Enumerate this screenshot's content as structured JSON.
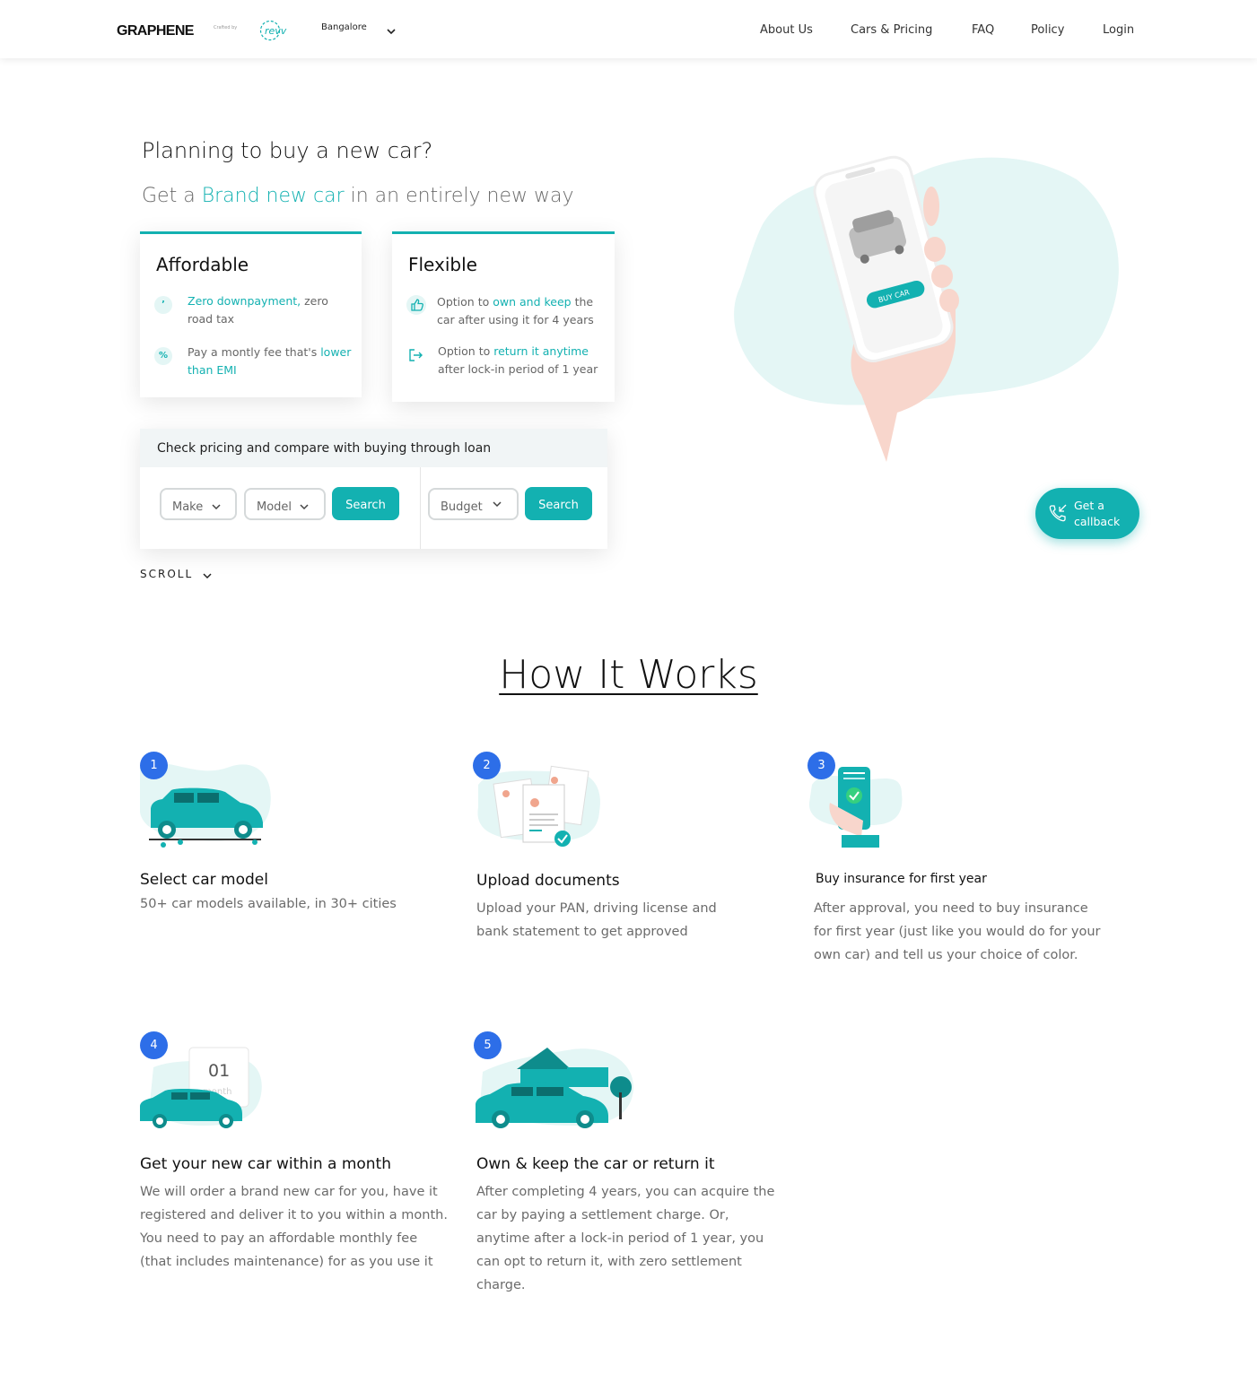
{
  "nav": {
    "logo": "GRAPHENE",
    "crafted_by": "Crafted by",
    "partner": "revv",
    "city": "Bangalore",
    "links": [
      "About Us",
      "Cars & Pricing",
      "FAQ",
      "Policy",
      "Login"
    ]
  },
  "hero": {
    "title": "Planning to buy a new car?",
    "sub_prefix": "Get a ",
    "sub_accent": "Brand new car",
    "sub_suffix": " in an entirely new way",
    "phone_button": "BUY CAR"
  },
  "cards": {
    "affordable": {
      "title": "Affordable",
      "f1_icon": "’",
      "f1_hl": "Zero downpayment,",
      "f1_rest": " zero road tax",
      "f2_icon": "%",
      "f2_pre": "Pay a montly fee that's ",
      "f2_hl": "lower than EMI"
    },
    "flexible": {
      "title": "Flexible",
      "f1_pre": "Option to ",
      "f1_hl": "own and keep",
      "f1_rest": " the car after using it for 4 years",
      "f2_pre": "Option to ",
      "f2_hl": "return it anytime",
      "f2_rest": " after lock-in period of 1 year"
    }
  },
  "pricing": {
    "heading": "Check pricing and compare with buying through loan",
    "make": "Make",
    "model": "Model",
    "budget": "Budget",
    "search": "Search"
  },
  "scroll_label": "SCROLL",
  "callback": {
    "line1": "Get a",
    "line2": "callback"
  },
  "how_it_works": {
    "title": "How It Works",
    "steps": [
      {
        "num": "1",
        "title": "Select car model",
        "desc": "50+ car models available, in 30+ cities"
      },
      {
        "num": "2",
        "title": "Upload documents",
        "desc": "Upload your PAN, driving license and bank statement to get approved"
      },
      {
        "num": "3",
        "title": "Buy insurance for first year",
        "desc": "After approval, you need to buy insurance for first year (just like you would do for your own car) and tell us your choice of color."
      },
      {
        "num": "4",
        "title": "Get your new car within a month",
        "desc": "We will order a brand new car for you, have it registered and deliver it to you within a month. You need to pay an affordable monthly fee (that includes maintenance) for as you use it",
        "calendar_day": "01",
        "calendar_unit": "month"
      },
      {
        "num": "5",
        "title": "Own & keep the car or return it",
        "desc": "After completing 4 years, you can acquire the car by paying a settlement charge. Or, anytime after a lock-in period of 1 year, you can opt to return it, with zero settlement charge."
      }
    ]
  },
  "colors": {
    "accent": "#13b1b1",
    "badge": "#2d6ee8",
    "blob": "#e4f6f5"
  }
}
